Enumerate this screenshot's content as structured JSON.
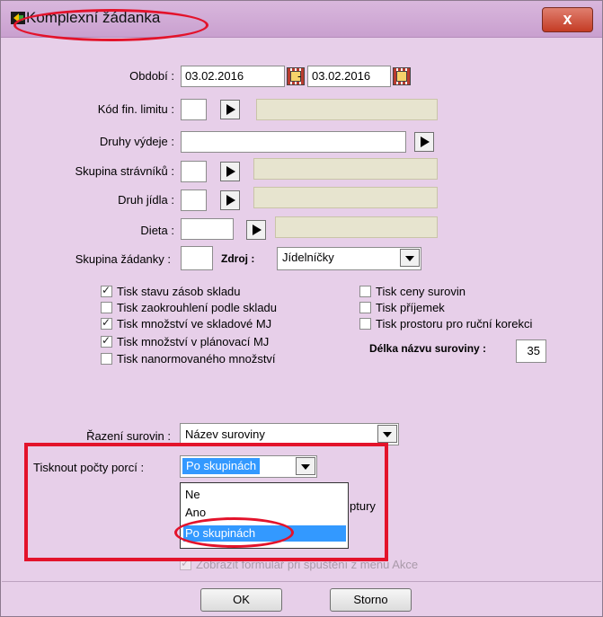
{
  "window": {
    "title": "Komplexní žádanka",
    "close_label": "x",
    "icon": "app-icon"
  },
  "form": {
    "obdobi_label": "Období :",
    "date_from": "03.02.2016",
    "date_separator": "-",
    "date_to": "03.02.2016",
    "kod_fin_label": "Kód fin. limitu :",
    "druhy_vydeje_label": "Druhy výdeje :",
    "skupina_stravniku_label": "Skupina strávníků :",
    "druh_jidla_label": "Druh jídla :",
    "dieta_label": "Dieta :",
    "skupina_zadanky_label": "Skupina žádanky :",
    "zdroj_label": "Zdroj :",
    "zdroj_value": "Jídelníčky"
  },
  "checkboxes_left": [
    {
      "label": "Tisk stavu zásob skladu",
      "checked": true
    },
    {
      "label": "Tisk zaokrouhlení podle skladu",
      "checked": false
    },
    {
      "label": "Tisk množství ve skladové MJ",
      "checked": true
    },
    {
      "label": "Tisk množství v plánovací MJ",
      "checked": true
    },
    {
      "label": "Tisk nanormovaného množství",
      "checked": false
    }
  ],
  "checkboxes_right": [
    {
      "label": "Tisk ceny surovin",
      "checked": false
    },
    {
      "label": "Tisk příjemek",
      "checked": false
    },
    {
      "label": "Tisk prostoru pro ruční korekci",
      "checked": false
    }
  ],
  "delka": {
    "label": "Délka názvu suroviny :",
    "value": "35"
  },
  "razeni": {
    "label": "Řazení surovin :",
    "value": "Název suroviny"
  },
  "tisknout": {
    "label": "Tisknout počty porcí :",
    "value": "Po skupinách",
    "options": [
      "Ne",
      "Ano",
      "Po skupinách"
    ]
  },
  "hidden_fragment": "ptury",
  "zobrazit": {
    "label": "Zobrazit formulář při spuštění z menu Akce",
    "checked": true
  },
  "buttons": {
    "ok": "OK",
    "storno": "Storno"
  },
  "colors": {
    "background": "#e7cfe9",
    "highlight": "#e3132b",
    "selection": "#3399ff"
  }
}
